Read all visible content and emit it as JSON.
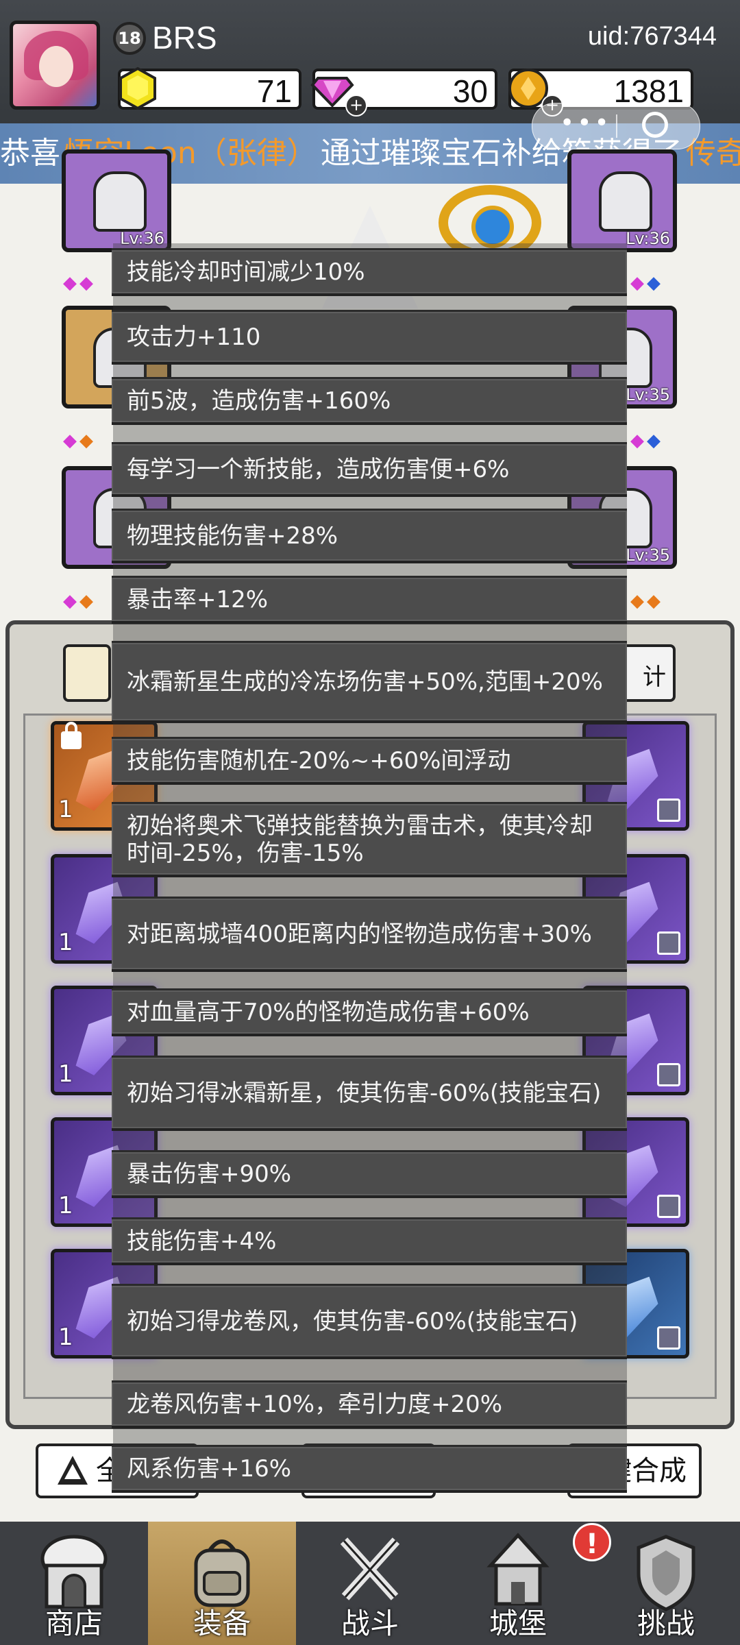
{
  "header": {
    "level": "18",
    "player_name": "BRS",
    "uid": "uid:767344",
    "resources": [
      {
        "icon": "gold-hexagon-icon",
        "value": "71"
      },
      {
        "icon": "purple-diamond-icon",
        "value": "30"
      },
      {
        "icon": "gold-coin-icon",
        "value": "1381"
      }
    ]
  },
  "marquee": {
    "parts": [
      {
        "text": "恭喜",
        "color": "#ffffff"
      },
      {
        "text": "悟空Leon（张律）",
        "color": "#f39a2c"
      },
      {
        "text": "通过璀璨宝石补给箱获得了",
        "color": "#ffffff"
      },
      {
        "text": "传奇",
        "color": "#f39a2c"
      }
    ]
  },
  "equipment": {
    "slot_levels": [
      "Lv:36",
      "Lv:36",
      "Lv:35",
      "Lv:35"
    ]
  },
  "inventory": {
    "stats_button_label": "计",
    "counts": [
      "1",
      "1",
      "1",
      "1",
      "1",
      "1"
    ]
  },
  "actions": {
    "all_label": "全部",
    "synth_label": "键合成"
  },
  "stats_list": [
    "技能冷却时间减少10%",
    "攻击力+110",
    "前5波，造成伤害+160%",
    "每学习一个新技能，造成伤害便+6%",
    "物理技能伤害+28%",
    "暴击率+12%",
    "冰霜新星生成的冷冻场伤害+50%,范围+20%",
    "技能伤害随机在-20%~+60%间浮动",
    "初始将奥术飞弹技能替换为雷击术，使其冷却时间-25%，伤害-15%",
    "对距离城墙400距离内的怪物造成伤害+30%",
    "对血量高于70%的怪物造成伤害+60%",
    "初始习得冰霜新星，使其伤害-60%(技能宝石)",
    "暴击伤害+90%",
    "技能伤害+4%",
    "初始习得龙卷风，使其伤害-60%(技能宝石)",
    "龙卷风伤害+10%，牵引力度+20%",
    "风系伤害+16%"
  ],
  "nav": {
    "items": [
      {
        "label": "商店",
        "icon": "shop-icon"
      },
      {
        "label": "装备",
        "icon": "backpack-icon"
      },
      {
        "label": "战斗",
        "icon": "crossed-swords-icon"
      },
      {
        "label": "城堡",
        "icon": "castle-icon"
      },
      {
        "label": "挑战",
        "icon": "challenge-shield-icon"
      }
    ],
    "active_index": 1,
    "alert_badge": "!"
  },
  "colors": {
    "header_bg": "#3b3f44",
    "marquee_bg": "#6f93c2",
    "highlight_orange": "#f39a2c",
    "stat_row_bg": "#4c4c4c",
    "nav_active": "#b8955a"
  }
}
